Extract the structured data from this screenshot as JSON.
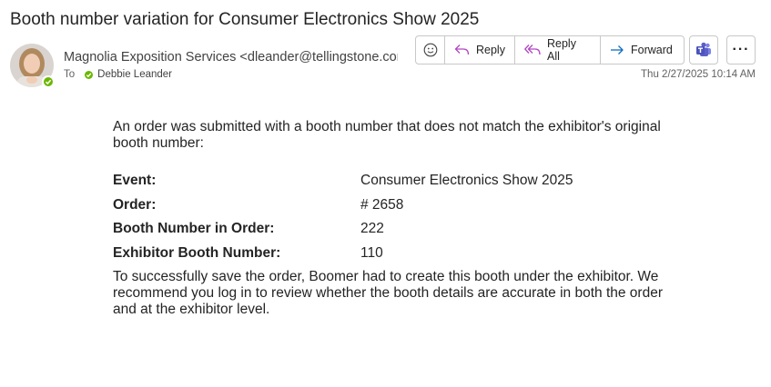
{
  "email": {
    "subject": "Booth number variation for Consumer Electronics Show 2025",
    "sender": "Magnolia Exposition Services <dleander@tellingstone.com>",
    "to_label": "To",
    "recipient": "Debbie Leander",
    "timestamp": "Thu 2/27/2025 10:14 AM"
  },
  "actions": {
    "reply_label": "Reply",
    "reply_all_label": "Reply All",
    "forward_label": "Forward",
    "more_label": "···"
  },
  "body": {
    "intro": "An order was submitted with a booth number that does not match the exhibitor's original booth number:",
    "details": [
      {
        "label": "Event:",
        "value": "Consumer Electronics Show 2025"
      },
      {
        "label": "Order:",
        "value": "# 2658"
      },
      {
        "label": "Booth Number in Order:",
        "value": "222"
      },
      {
        "label": "Exhibitor Booth Number:",
        "value": "110"
      }
    ],
    "closing": "To successfully save the order, Boomer had to create this booth under the exhibitor. We recommend you log in to review whether the booth details are accurate in both the order and at the exhibitor level."
  },
  "icons": {
    "emoji": "emoji-icon",
    "reply": "reply-icon",
    "reply_all": "reply-all-icon",
    "forward": "forward-icon",
    "teams": "teams-icon",
    "presence": "presence-available-icon"
  },
  "colors": {
    "accent_purple": "#b146c2",
    "forward_blue": "#0f6cbd",
    "presence_green": "#6bb700",
    "teams_purple": "#5b5fc7"
  }
}
